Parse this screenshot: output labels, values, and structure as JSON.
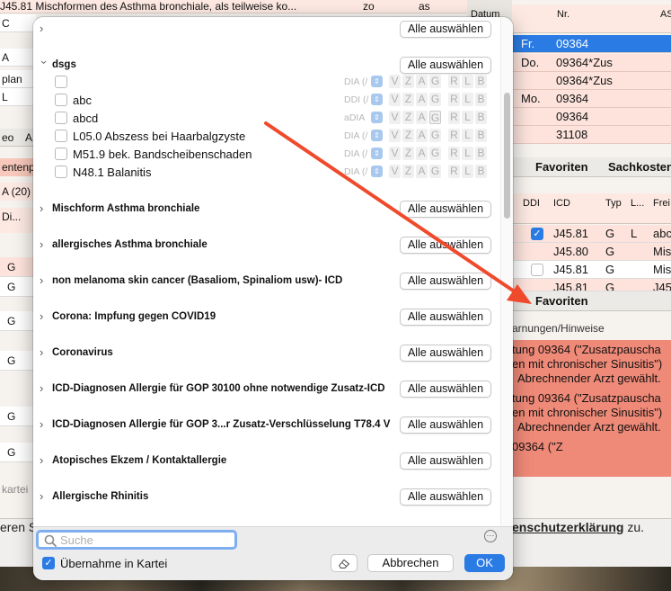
{
  "background": {
    "top_line": "J45.81 Mischformen des Asthma bronchiale, als teilweise ko...",
    "top_line_col2": "zo",
    "top_line_col3": "as",
    "left_rows": [
      "C",
      "A",
      "plan",
      "L"
    ],
    "left_tab": "eo",
    "left_tab2": "A",
    "left_red1": "entenp",
    "left_red2": "A (20)",
    "left_red3": "Di...",
    "left_g_rows": [
      "G",
      "G",
      "G",
      "G",
      "G",
      "G"
    ],
    "left_footer": "kartei",
    "footer_left_text": "eren S",
    "footer_right_text": "enschutzerklärung",
    "footer_right_suffix": "zu.",
    "right_header": {
      "datum": "Datum",
      "nr": "Nr.",
      "as": "AS"
    },
    "right_rows": [
      {
        "day": "Fr.",
        "nr": "09364"
      },
      {
        "day": "Do.",
        "nr": "09364*Zus"
      },
      {
        "day": "",
        "nr": "09364*Zus"
      },
      {
        "day": "Mo.",
        "nr": "09364"
      },
      {
        "day": "",
        "nr": "09364"
      },
      {
        "day": "",
        "nr": "31108"
      }
    ],
    "right_tabs": [
      "Favoriten",
      "Sachkosten"
    ],
    "right_header2": {
      "ddi": "DDI",
      "icd": "ICD",
      "typ": "Typ",
      "l": "L...",
      "frei": "Frei"
    },
    "right_rows2": [
      {
        "icd": "J45.81",
        "typ": "G",
        "l": "L",
        "frei": "abc"
      },
      {
        "icd": "J45.80",
        "typ": "G",
        "l": "",
        "frei": "Mis"
      },
      {
        "icd": "J45.81",
        "typ": "G",
        "l": "",
        "frei": "Mis"
      },
      {
        "icd": "J45.81",
        "typ": "G",
        "l": "",
        "frei": "J45"
      }
    ],
    "right_tab2": "Favoriten",
    "warn_title": "arnungen/Hinweise",
    "warn_lines": [
      "tung 09364 (\"Zusatzpauscha",
      "en mit chronischer Sinusitis\")",
      "Abrechnender Arzt gewählt.",
      "tung 09364 (\"Zusatzpauscha",
      "en mit chronischer Sinusitis\")",
      "Abrechnender Arzt gewählt.",
      "   09364 (\"Z"
    ]
  },
  "dialog": {
    "select_all_label": "Alle auswählen",
    "groups": [
      {
        "title": "",
        "expanded": false
      },
      {
        "title": "dsgs",
        "expanded": true
      },
      {
        "title": "Mischform Asthma bronchiale",
        "expanded": false
      },
      {
        "title": "allergisches Asthma bronchiale",
        "expanded": false
      },
      {
        "title": "non melanoma skin cancer (Basaliom, Spinaliom usw)- ICD",
        "expanded": false
      },
      {
        "title": "Corona: Impfung gegen COVID19",
        "expanded": false
      },
      {
        "title": "Coronavirus",
        "expanded": false
      },
      {
        "title": "ICD-Diagnosen Allergie für GOP 30100 ohne notwendige Zusatz-ICD",
        "expanded": false
      },
      {
        "title": "ICD-Diagnosen Allergie für GOP 3...r Zusatz-Verschlüsselung T78.4 V",
        "expanded": false
      },
      {
        "title": "Atopisches Ekzem / Kontaktallergie",
        "expanded": false
      },
      {
        "title": "Allergische Rhinitis",
        "expanded": false
      }
    ],
    "dsgs_items": [
      {
        "label": "",
        "dia": "DIA (/",
        "checked": false
      },
      {
        "label": "abc",
        "dia": "DDI (/",
        "checked": false
      },
      {
        "label": "abcd",
        "dia": "aDIA",
        "checked": false
      },
      {
        "label": "L05.0 Abszess bei Haarbalgzyste",
        "dia": "DIA (/",
        "checked": false
      },
      {
        "label": "M51.9 bek. Bandscheibenschaden",
        "dia": "DIA (/",
        "checked": false
      },
      {
        "label": "N48.1 Balanitis",
        "dia": "DIA (/",
        "checked": false
      }
    ],
    "flag_letters": [
      "V",
      "Z",
      "A",
      "G",
      "R",
      "L",
      "B"
    ],
    "search_placeholder": "Suche",
    "transfer_label": "Übernahme in Kartei",
    "transfer_checked": true,
    "cancel_label": "Abbrechen",
    "ok_label": "OK"
  },
  "colors": {
    "accent": "#2a7be4",
    "warning": "#f08a78",
    "pink_row": "#fde3dc",
    "annotation_arrow": "#f04a2c"
  }
}
